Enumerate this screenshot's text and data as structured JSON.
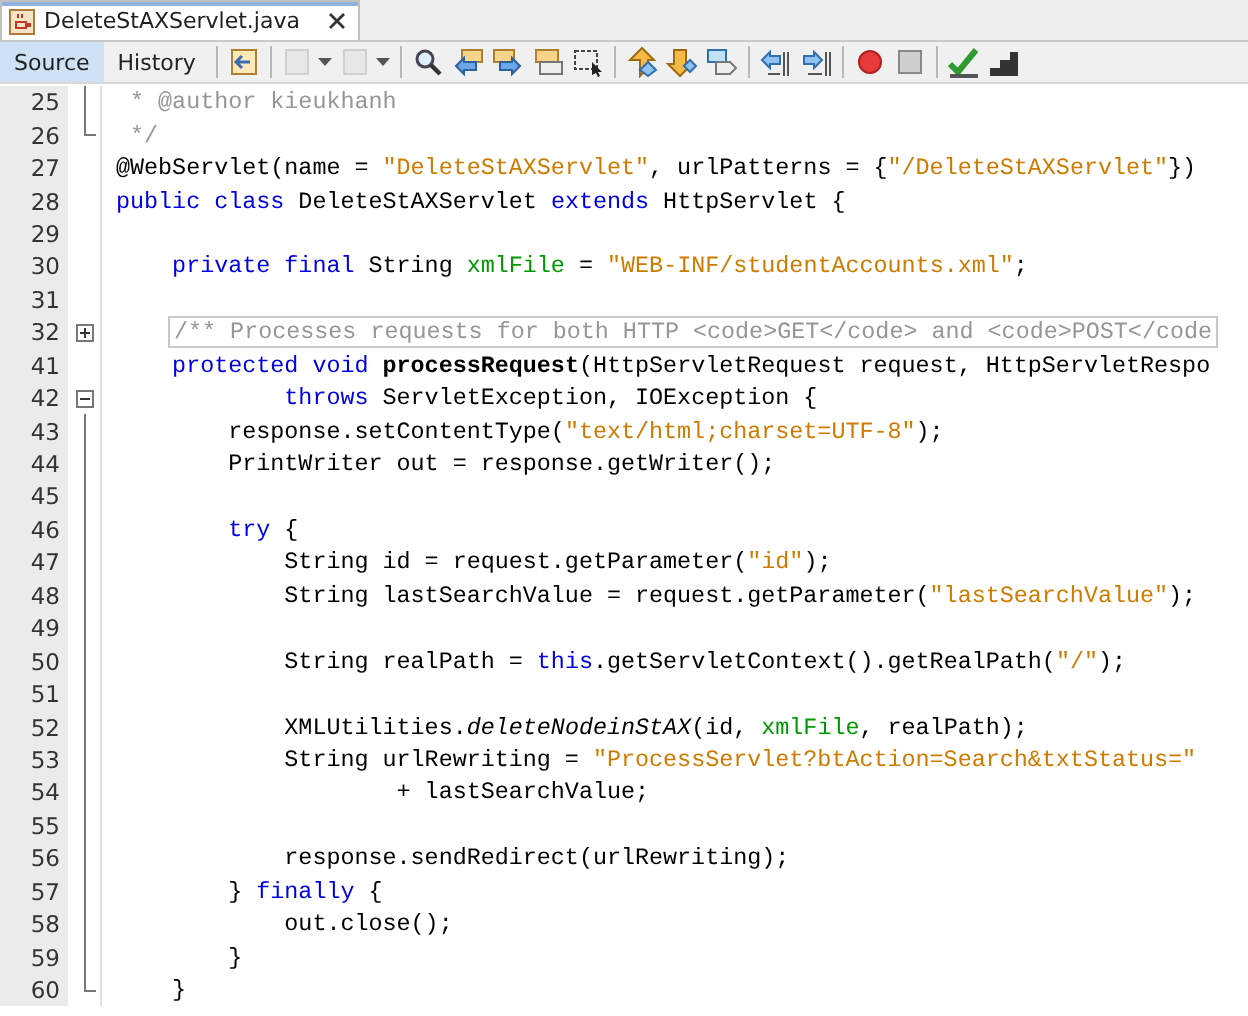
{
  "file_tab": {
    "label": "DeleteStAXServlet.java",
    "selected": true
  },
  "view_tabs": [
    {
      "label": "Source",
      "selected": true
    },
    {
      "label": "History",
      "selected": false
    }
  ],
  "toolbar": [
    {
      "kind": "last-edit",
      "disabled": false
    },
    {
      "kind": "back",
      "disabled": true
    },
    {
      "kind": "forward",
      "disabled": true
    },
    {
      "kind": "find",
      "disabled": false
    },
    {
      "kind": "find-prev",
      "disabled": false
    },
    {
      "kind": "find-next",
      "disabled": false
    },
    {
      "kind": "highlight",
      "disabled": false
    },
    {
      "kind": "select",
      "disabled": false
    },
    {
      "kind": "up",
      "disabled": false
    },
    {
      "kind": "down",
      "disabled": false
    },
    {
      "kind": "bookmark",
      "disabled": false
    },
    {
      "kind": "shift-left",
      "disabled": false
    },
    {
      "kind": "shift-right",
      "disabled": false
    },
    {
      "kind": "record",
      "disabled": false
    },
    {
      "kind": "stop",
      "disabled": false
    },
    {
      "kind": "check",
      "disabled": false
    },
    {
      "kind": "steps",
      "disabled": false
    }
  ],
  "lines": [
    {
      "number": "25",
      "guide": {
        "end": false
      },
      "tokens": [
        {
          "kind": "comment",
          "text": " * @author kieukhanh"
        }
      ]
    },
    {
      "number": "26",
      "guide": {
        "end": true
      },
      "tokens": [
        {
          "kind": "comment",
          "text": " */"
        }
      ]
    },
    {
      "number": "27",
      "tokens": [
        {
          "kind": "plain",
          "text": "@WebServlet(name = "
        },
        {
          "kind": "string",
          "text": "\"DeleteStAXServlet\""
        },
        {
          "kind": "plain",
          "text": ", urlPatterns = {"
        },
        {
          "kind": "string",
          "text": "\"/DeleteStAXServlet\""
        },
        {
          "kind": "plain",
          "text": "})"
        }
      ]
    },
    {
      "number": "28",
      "tokens": [
        {
          "kind": "keyword",
          "text": "public class"
        },
        {
          "kind": "plain",
          "text": " DeleteStAXServlet "
        },
        {
          "kind": "keyword",
          "text": "extends"
        },
        {
          "kind": "plain",
          "text": " HttpServlet {"
        }
      ]
    },
    {
      "number": "29"
    },
    {
      "number": "30",
      "tokens": [
        {
          "kind": "keyword",
          "text": "    private final"
        },
        {
          "kind": "plain",
          "text": " String "
        },
        {
          "kind": "field",
          "text": "xmlFile"
        },
        {
          "kind": "plain",
          "text": " = "
        },
        {
          "kind": "string",
          "text": "\"WEB-INF/studentAccounts.xml\""
        },
        {
          "kind": "plain",
          "text": ";"
        }
      ]
    },
    {
      "number": "31"
    },
    {
      "number": "32",
      "fold": {
        "expanded": false
      },
      "tokens": [
        {
          "kind": "folded",
          "text": "/** Processes requests for both HTTP <code>GET</code> and <code>POST</code"
        }
      ]
    },
    {
      "number": "41",
      "tokens": [
        {
          "kind": "keyword",
          "text": "    protected void"
        },
        {
          "kind": "method",
          "text": " processRequest"
        },
        {
          "kind": "plain",
          "text": "(HttpServletRequest request, HttpServletRespo"
        }
      ]
    },
    {
      "number": "42",
      "fold": {
        "expanded": true
      },
      "tokens": [
        {
          "kind": "keyword",
          "text": "            throws"
        },
        {
          "kind": "plain",
          "text": " ServletException, IOException {"
        }
      ]
    },
    {
      "number": "43",
      "guide": {
        "end": false
      },
      "tokens": [
        {
          "kind": "plain",
          "text": "        response.setContentType("
        },
        {
          "kind": "string",
          "text": "\"text/html;charset=UTF-8\""
        },
        {
          "kind": "plain",
          "text": ");"
        }
      ]
    },
    {
      "number": "44",
      "guide": {
        "end": false
      },
      "tokens": [
        {
          "kind": "plain",
          "text": "        PrintWriter out = response.getWriter();"
        }
      ]
    },
    {
      "number": "45",
      "guide": {
        "end": false
      }
    },
    {
      "number": "46",
      "guide": {
        "end": false
      },
      "tokens": [
        {
          "kind": "keyword",
          "text": "        try"
        },
        {
          "kind": "plain",
          "text": " {"
        }
      ]
    },
    {
      "number": "47",
      "guide": {
        "end": false
      },
      "tokens": [
        {
          "kind": "plain",
          "text": "            String id = request.getParameter("
        },
        {
          "kind": "string",
          "text": "\"id\""
        },
        {
          "kind": "plain",
          "text": ");"
        }
      ]
    },
    {
      "number": "48",
      "guide": {
        "end": false
      },
      "tokens": [
        {
          "kind": "plain",
          "text": "            String lastSearchValue = request.getParameter("
        },
        {
          "kind": "string",
          "text": "\"lastSearchValue\""
        },
        {
          "kind": "plain",
          "text": ");"
        }
      ]
    },
    {
      "number": "49",
      "guide": {
        "end": false
      }
    },
    {
      "number": "50",
      "guide": {
        "end": false
      },
      "tokens": [
        {
          "kind": "plain",
          "text": "            String realPath = "
        },
        {
          "kind": "keyword",
          "text": "this"
        },
        {
          "kind": "plain",
          "text": ".getServletContext().getRealPath("
        },
        {
          "kind": "string",
          "text": "\"/\""
        },
        {
          "kind": "plain",
          "text": ");"
        }
      ]
    },
    {
      "number": "51",
      "guide": {
        "end": false
      }
    },
    {
      "number": "52",
      "guide": {
        "end": false
      },
      "tokens": [
        {
          "kind": "plain",
          "text": "            XMLUtilities."
        },
        {
          "kind": "static",
          "text": "deleteNodeinStAX"
        },
        {
          "kind": "plain",
          "text": "(id, "
        },
        {
          "kind": "field",
          "text": "xmlFile"
        },
        {
          "kind": "plain",
          "text": ", realPath);"
        }
      ]
    },
    {
      "number": "53",
      "guide": {
        "end": false
      },
      "tokens": [
        {
          "kind": "plain",
          "text": "            String urlRewriting = "
        },
        {
          "kind": "string",
          "text": "\"ProcessServlet?btAction=Search&txtStatus=\""
        }
      ]
    },
    {
      "number": "54",
      "guide": {
        "end": false
      },
      "tokens": [
        {
          "kind": "plain",
          "text": "                    + lastSearchValue;"
        }
      ]
    },
    {
      "number": "55",
      "guide": {
        "end": false
      }
    },
    {
      "number": "56",
      "guide": {
        "end": false
      },
      "tokens": [
        {
          "kind": "plain",
          "text": "            response.sendRedirect(urlRewriting);"
        }
      ]
    },
    {
      "number": "57",
      "guide": {
        "end": false
      },
      "tokens": [
        {
          "kind": "plain",
          "text": "        } "
        },
        {
          "kind": "keyword",
          "text": "finally"
        },
        {
          "kind": "plain",
          "text": " {"
        }
      ]
    },
    {
      "number": "58",
      "guide": {
        "end": false
      },
      "tokens": [
        {
          "kind": "plain",
          "text": "            out.close();"
        }
      ]
    },
    {
      "number": "59",
      "guide": {
        "end": false
      },
      "tokens": [
        {
          "kind": "plain",
          "text": "        }"
        }
      ]
    },
    {
      "number": "60",
      "guide": {
        "end": true
      },
      "tokens": [
        {
          "kind": "plain",
          "text": "    }"
        }
      ]
    }
  ]
}
